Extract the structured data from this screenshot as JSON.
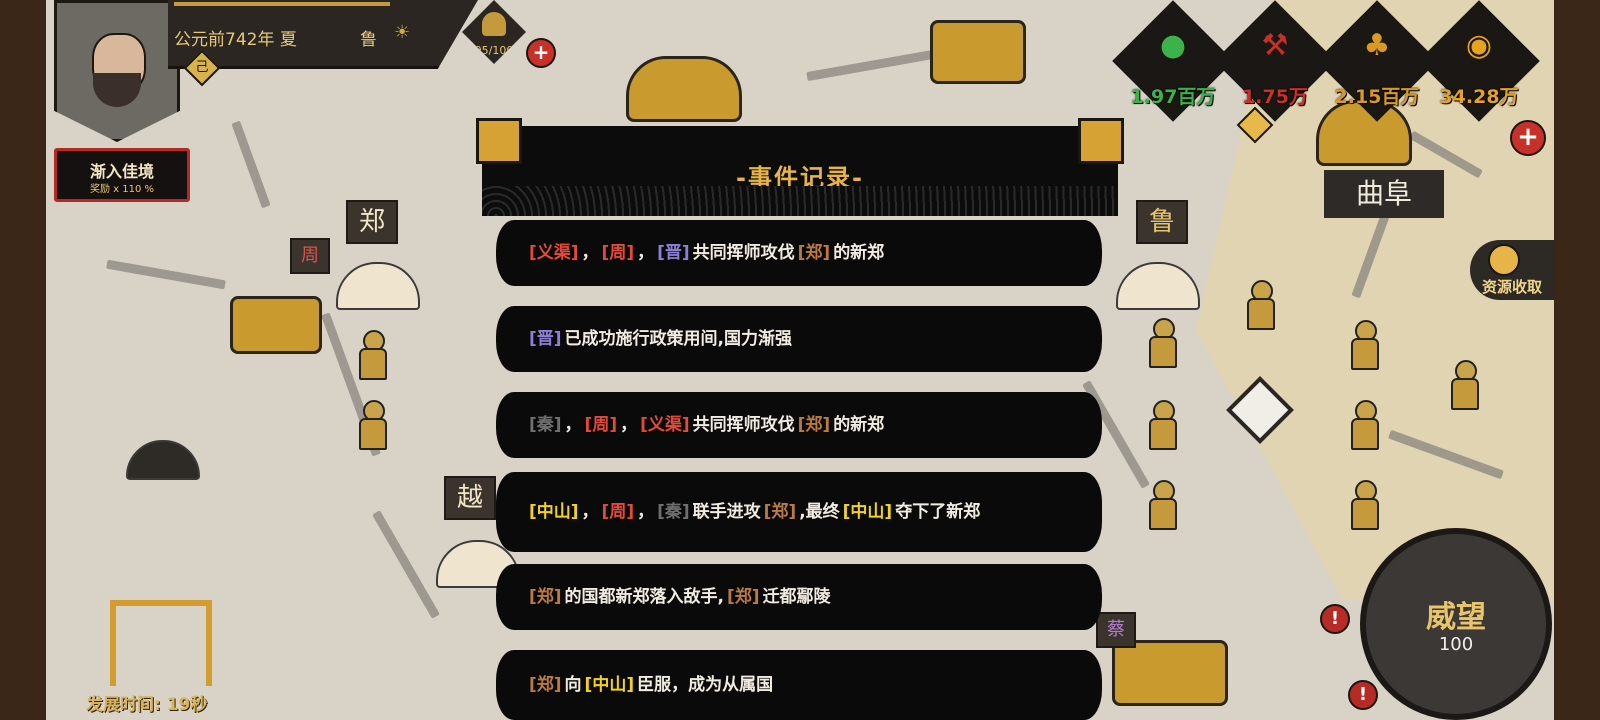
{
  "hud": {
    "date_label": "公元前742年 夏",
    "state_name": "鲁",
    "rank_badge": "己",
    "troops": "95/100",
    "status_title": "渐入佳境",
    "status_sub": "奖励 x 110 %"
  },
  "resources": [
    {
      "name": "population",
      "icon": "person-icon",
      "value": "1.97百万",
      "color": "#3bb24a"
    },
    {
      "name": "military",
      "icon": "pickaxe-icon",
      "value": "1.75万",
      "color": "#c8312a"
    },
    {
      "name": "grain",
      "icon": "wheat-icon",
      "value": "2.15百万",
      "color": "#d99a22"
    },
    {
      "name": "money",
      "icon": "coin-icon",
      "value": "34.28万",
      "color": "#e6a31d"
    }
  ],
  "map": {
    "city_name": "曲阜",
    "flags": [
      "郑",
      "周",
      "越",
      "鲁",
      "蔡"
    ],
    "collect_label": "资源收取"
  },
  "prestige": {
    "label": "威望",
    "value": "100"
  },
  "dev_time": "发展时间: 19秒",
  "event_log": {
    "title": "-事件记录-",
    "events": [
      {
        "parts": [
          {
            "type": "tag",
            "text": "义渠",
            "color": "#e24a3c"
          },
          {
            "type": "text",
            "text": "，"
          },
          {
            "type": "tag",
            "text": "周",
            "color": "#e24a3c"
          },
          {
            "type": "text",
            "text": "，"
          },
          {
            "type": "tag",
            "text": "晋",
            "color": "#8b7fd6"
          },
          {
            "type": "text",
            "text": "共同挥师攻伐"
          },
          {
            "type": "tag",
            "text": "郑",
            "color": "#b97a44"
          },
          {
            "type": "text",
            "text": "的新郑"
          }
        ]
      },
      {
        "parts": [
          {
            "type": "tag",
            "text": "晋",
            "color": "#8b7fd6"
          },
          {
            "type": "text",
            "text": "已成功施行政策用间,国力渐强"
          }
        ]
      },
      {
        "parts": [
          {
            "type": "tag",
            "text": "秦",
            "color": "#6f6f6f"
          },
          {
            "type": "text",
            "text": "，"
          },
          {
            "type": "tag",
            "text": "周",
            "color": "#e24a3c"
          },
          {
            "type": "text",
            "text": "，"
          },
          {
            "type": "tag",
            "text": "义渠",
            "color": "#e24a3c"
          },
          {
            "type": "text",
            "text": "共同挥师攻伐"
          },
          {
            "type": "tag",
            "text": "郑",
            "color": "#b97a44"
          },
          {
            "type": "text",
            "text": "的新郑"
          }
        ]
      },
      {
        "parts": [
          {
            "type": "tag",
            "text": "中山",
            "color": "#f1d21c"
          },
          {
            "type": "text",
            "text": "，"
          },
          {
            "type": "tag",
            "text": "周",
            "color": "#e24a3c"
          },
          {
            "type": "text",
            "text": "，"
          },
          {
            "type": "tag",
            "text": "秦",
            "color": "#6f6f6f"
          },
          {
            "type": "text",
            "text": "联手进攻"
          },
          {
            "type": "tag",
            "text": "郑",
            "color": "#b97a44"
          },
          {
            "type": "text",
            "text": ",最终"
          },
          {
            "type": "tag",
            "text": "中山",
            "color": "#f1d21c"
          },
          {
            "type": "text",
            "text": "夺下了新郑"
          }
        ]
      },
      {
        "parts": [
          {
            "type": "tag",
            "text": "郑",
            "color": "#b97a44"
          },
          {
            "type": "text",
            "text": "的国都新郑落入敌手,"
          },
          {
            "type": "tag",
            "text": "郑",
            "color": "#b97a44"
          },
          {
            "type": "text",
            "text": "迁都鄢陵"
          }
        ]
      },
      {
        "parts": [
          {
            "type": "tag",
            "text": "郑",
            "color": "#b97a44"
          },
          {
            "type": "text",
            "text": "向"
          },
          {
            "type": "tag",
            "text": "中山",
            "color": "#f1d21c"
          },
          {
            "type": "text",
            "text": "臣服，成为从属国"
          }
        ]
      }
    ]
  }
}
